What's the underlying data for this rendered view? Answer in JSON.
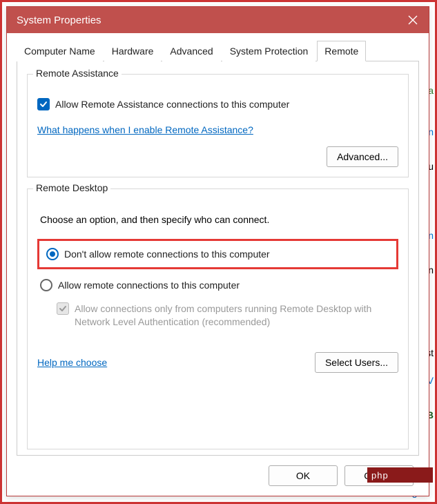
{
  "window": {
    "title": "System Properties"
  },
  "tabs": [
    {
      "label": "Computer Name"
    },
    {
      "label": "Hardware"
    },
    {
      "label": "Advanced"
    },
    {
      "label": "System Protection"
    },
    {
      "label": "Remote",
      "active": true
    }
  ],
  "remote_assistance": {
    "legend": "Remote Assistance",
    "allow_label": "Allow Remote Assistance connections to this computer",
    "help_link": "What happens when I enable Remote Assistance?",
    "advanced_btn": "Advanced..."
  },
  "remote_desktop": {
    "legend": "Remote Desktop",
    "intro": "Choose an option, and then specify who can connect.",
    "opt_dont_allow": "Don't allow remote connections to this computer",
    "opt_allow": "Allow remote connections to this computer",
    "nla_label": "Allow connections only from computers running Remote Desktop with Network Level Authentication (recommended)",
    "help_link": "Help me choose",
    "select_users_btn": "Select Users..."
  },
  "buttons": {
    "ok": "OK",
    "cancel": "Cancel"
  },
  "background": {
    "php": "php",
    "manage": "Manage \\"
  }
}
